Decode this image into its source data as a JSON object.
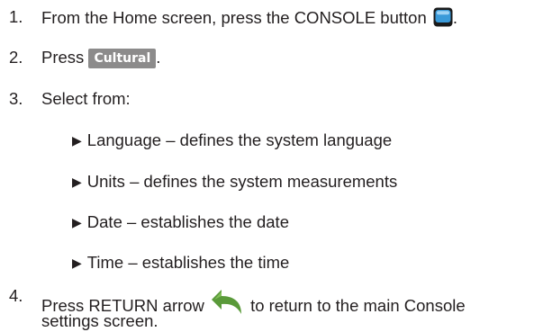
{
  "steps": [
    {
      "num": "1.",
      "before": "From the Home screen, press the CONSOLE button",
      "after": "."
    },
    {
      "num": "2.",
      "before": "Press",
      "button": "Cultural",
      "after": "."
    },
    {
      "num": "3.",
      "text": "Select from:"
    },
    {
      "num": "4.",
      "before": "Press RETURN arrow",
      "after": "to return to the main Console",
      "cont": "settings screen."
    }
  ],
  "options": [
    "Language – defines the system language",
    "Units – defines the system measurements",
    "Date – establishes the date",
    "Time – establishes the time"
  ],
  "icons": {
    "console": "console-button-icon",
    "return": "return-arrow-icon",
    "bullet": "right-triangle-bullet"
  },
  "colors": {
    "cultural_bg": "#8c8b8b",
    "console_blue": "#3a9ad9",
    "return_green": "#5a9a3a"
  }
}
